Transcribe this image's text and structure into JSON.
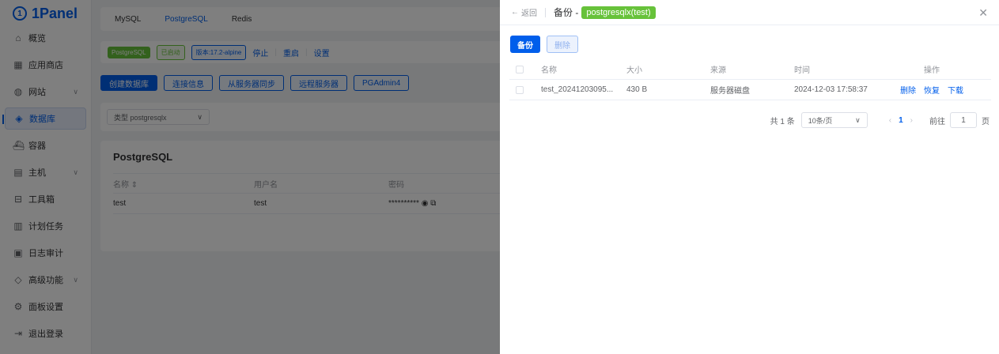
{
  "brand": {
    "logo_text": "1Panel"
  },
  "sidebar": {
    "items": [
      {
        "label": "概览",
        "icon": "home-icon"
      },
      {
        "label": "应用商店",
        "icon": "apps-icon"
      },
      {
        "label": "网站",
        "icon": "globe-icon"
      },
      {
        "label": "数据库",
        "icon": "database-icon"
      },
      {
        "label": "容器",
        "icon": "container-icon"
      },
      {
        "label": "主机",
        "icon": "host-icon"
      },
      {
        "label": "工具箱",
        "icon": "toolbox-icon"
      },
      {
        "label": "计划任务",
        "icon": "cron-icon"
      },
      {
        "label": "日志审计",
        "icon": "log-icon"
      },
      {
        "label": "高级功能",
        "icon": "diamond-icon"
      },
      {
        "label": "面板设置",
        "icon": "settings-icon"
      },
      {
        "label": "退出登录",
        "icon": "logout-icon"
      }
    ]
  },
  "db_tabs": [
    "MySQL",
    "PostgreSQL",
    "Redis"
  ],
  "status": {
    "app": "PostgreSQL",
    "state": "已启动",
    "version": "版本:17.2-alpine",
    "stop": "停止",
    "restart": "重启",
    "settings": "设置"
  },
  "toolbar": {
    "create": "创建数据库",
    "conn": "连接信息",
    "sync": "从服务器同步",
    "remote": "远程服务器",
    "pgadmin": "PGAdmin4"
  },
  "filter": {
    "select_value": "类型 postgresqlx"
  },
  "db_list": {
    "title": "PostgreSQL",
    "headers": {
      "name": "名称 ⇕",
      "user": "用户名",
      "password": "密码"
    },
    "rows": [
      {
        "name": "test",
        "user": "test",
        "password": "**********"
      }
    ]
  },
  "drawer": {
    "back": "返回",
    "title_prefix": "备份 -",
    "title_tag": "postgresqlx(test)",
    "backup_button": "备份",
    "delete_button": "删除",
    "headers": {
      "name": "名称",
      "size": "大小",
      "source": "来源",
      "time": "时间",
      "ops": "操作"
    },
    "rows": [
      {
        "name": "test_20241203095...",
        "size": "430 B",
        "source": "服务器磁盘",
        "time": "2024-12-03 17:58:37",
        "op_delete": "删除",
        "op_restore": "恢复",
        "op_download": "下载"
      }
    ],
    "pagination": {
      "total": "共 1 条",
      "page_size": "10条/页",
      "current": "1",
      "goto": "前往",
      "goto_value": "1",
      "page_unit": "页"
    }
  },
  "colors": {
    "accent": "#005eeb",
    "success": "#67c23a"
  }
}
